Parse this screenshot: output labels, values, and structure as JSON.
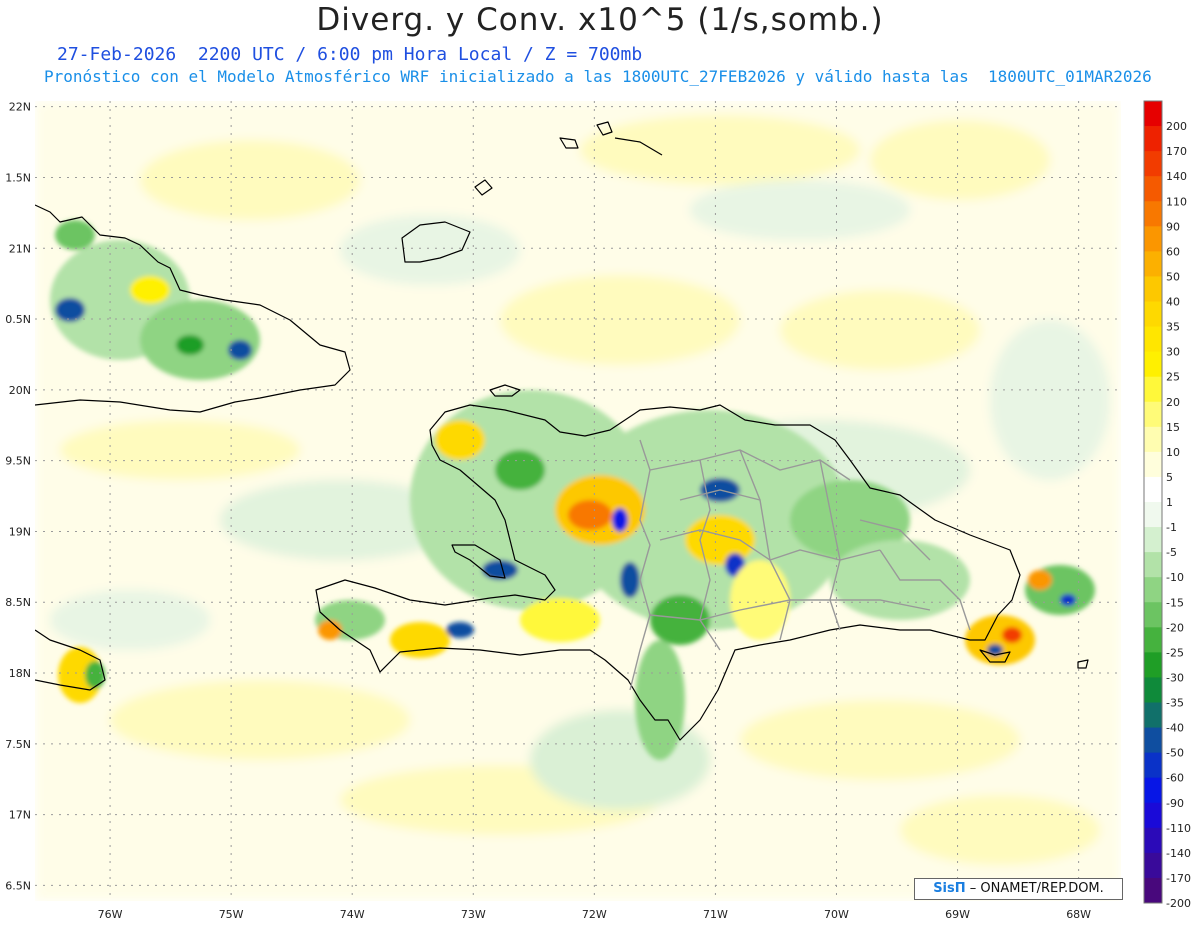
{
  "header": {
    "title": "Diverg. y Conv. x10^5 (1/s,somb.)",
    "subtitle_line1": "27-Feb-2026  2200 UTC / 6:00 pm Hora Local / Z = 700mb",
    "subtitle_line2": "Pronóstico con el Modelo Atmosférico WRF inicializado a las 1800UTC_27FEB2026 y válido hasta las  1800UTC_01MAR2026"
  },
  "map": {
    "lon_range": [
      -76.62,
      -67.65
    ],
    "lat_range": [
      16.39,
      22.04
    ],
    "lon_ticks": [
      {
        "value": -76,
        "label": "76W"
      },
      {
        "value": -75,
        "label": "75W"
      },
      {
        "value": -74,
        "label": "74W"
      },
      {
        "value": -73,
        "label": "73W"
      },
      {
        "value": -72,
        "label": "72W"
      },
      {
        "value": -71,
        "label": "71W"
      },
      {
        "value": -70,
        "label": "70W"
      },
      {
        "value": -69,
        "label": "69W"
      },
      {
        "value": -68,
        "label": "68W"
      }
    ],
    "lat_ticks": [
      {
        "value": 22,
        "label": "22N"
      },
      {
        "value": 21.5,
        "label": "1.5N"
      },
      {
        "value": 21,
        "label": "21N"
      },
      {
        "value": 20.5,
        "label": "0.5N"
      },
      {
        "value": 20,
        "label": "20N"
      },
      {
        "value": 19.5,
        "label": "9.5N"
      },
      {
        "value": 19,
        "label": "19N"
      },
      {
        "value": 18.5,
        "label": "8.5N"
      },
      {
        "value": 18,
        "label": "18N"
      },
      {
        "value": 17.5,
        "label": "7.5N"
      },
      {
        "value": 17,
        "label": "17N"
      },
      {
        "value": 16.5,
        "label": "6.5N"
      }
    ],
    "gridlines": true,
    "colors": {
      "coastline": "#000000",
      "province_borders": "#999999"
    }
  },
  "legend": {
    "position": "right",
    "bins": [
      {
        "label": "200",
        "color": "#e60000"
      },
      {
        "label": "170",
        "color": "#ee2200"
      },
      {
        "label": "140",
        "color": "#f23c00"
      },
      {
        "label": "110",
        "color": "#f55a00"
      },
      {
        "label": "90",
        "color": "#f87800"
      },
      {
        "label": "60",
        "color": "#fb9600"
      },
      {
        "label": "50",
        "color": "#fcb000"
      },
      {
        "label": "40",
        "color": "#fdc800"
      },
      {
        "label": "35",
        "color": "#fed900"
      },
      {
        "label": "30",
        "color": "#ffe600"
      },
      {
        "label": "25",
        "color": "#fff000"
      },
      {
        "label": "20",
        "color": "#fff83a"
      },
      {
        "label": "15",
        "color": "#fffb78"
      },
      {
        "label": "10",
        "color": "#fffdb0"
      },
      {
        "label": "5",
        "color": "#fffedc"
      },
      {
        "label": "1",
        "color": "#ffffff"
      },
      {
        "label": "-1",
        "color": "#f0f9ee"
      },
      {
        "label": "-5",
        "color": "#d4f0cf"
      },
      {
        "label": "-10",
        "color": "#b2e2a8"
      },
      {
        "label": "-15",
        "color": "#8fd483"
      },
      {
        "label": "-20",
        "color": "#6cc462"
      },
      {
        "label": "-25",
        "color": "#45b23e"
      },
      {
        "label": "-30",
        "color": "#1f9e26"
      },
      {
        "label": "-35",
        "color": "#0f8a3a"
      },
      {
        "label": "-40",
        "color": "#11706a"
      },
      {
        "label": "-50",
        "color": "#0f4ea0"
      },
      {
        "label": "-60",
        "color": "#0a32c8"
      },
      {
        "label": "-90",
        "color": "#0716e6"
      },
      {
        "label": "-110",
        "color": "#1a0ad8"
      },
      {
        "label": "-140",
        "color": "#2b0ab8"
      },
      {
        "label": "-170",
        "color": "#390a9a"
      },
      {
        "label": "-200",
        "color": "#48087c"
      }
    ]
  },
  "credit": {
    "brand": "SisΠ",
    "text": "– ONAMET/REP.DOM."
  }
}
